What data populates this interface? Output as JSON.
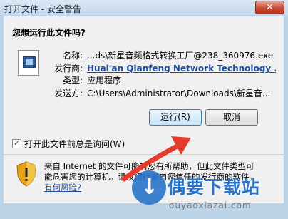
{
  "window": {
    "title": "打开文件 - 安全警告",
    "close_glyph": "✕"
  },
  "dialog": {
    "question": "您想运行此文件吗?",
    "fields": [
      {
        "label": "名称:",
        "value": "...ds\\新星音频格式转换工厂@238_360976.exe"
      },
      {
        "label": "发行商:",
        "value": "Huai'an Qianfeng Network Technology ..."
      },
      {
        "label": "类型:",
        "value": "应用程序"
      },
      {
        "label": "发送方:",
        "value": "C:\\Users\\Administrator\\Downloads\\新星音..."
      }
    ],
    "run_button": "运行(R)",
    "cancel_button": "取消",
    "checkbox_label": "打开此文件前总是询问(W)",
    "warning_line1": "来自 Internet 的文件可能对您有所帮助，但此文件类型可",
    "warning_line2": "能危害您的计算机。请仅运行来自您信任的发行商的软件。",
    "risk_link": "有何风险?"
  },
  "watermark": {
    "title": "偶要下载站",
    "url": "ouyaoxiazai.com"
  },
  "colors": {
    "link": "#1a4fa0",
    "close_red": "#c94a33",
    "arrow_red": "#e53b2c",
    "watermark_blue": "#2a74c8"
  }
}
